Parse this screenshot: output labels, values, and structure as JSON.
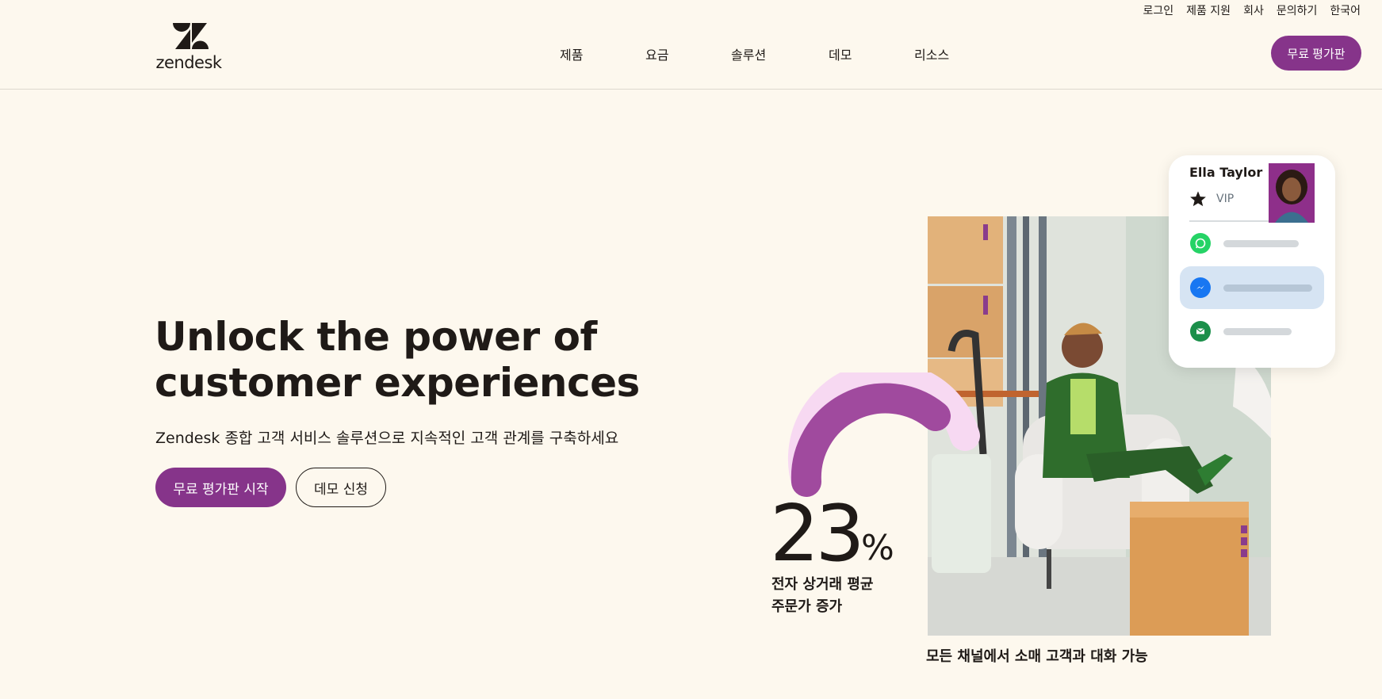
{
  "utility_nav": [
    "로그인",
    "제품 지원",
    "회사",
    "문의하기",
    "한국어"
  ],
  "logo": {
    "text": "zendesk"
  },
  "main_nav": [
    "제품",
    "요금",
    "솔루션",
    "데모",
    "리소스"
  ],
  "header_cta": "무료 평가판",
  "hero": {
    "title": "Unlock the power of customer experiences",
    "subtitle": "Zendesk 종합 고객 서비스 솔루션으로 지속적인 고객 관계를 구축하세요",
    "primary_cta": "무료 평가판 시작",
    "secondary_cta": "데모 신청"
  },
  "stat": {
    "value": "23",
    "unit": "%",
    "caption_line1": "전자 상거래 평균",
    "caption_line2": "주문가 증가",
    "gauge_fraction": 0.6
  },
  "photo_caption": "모든 채널에서 소매 고객과 대화 가능",
  "profile_card": {
    "name": "Ella Taylor",
    "tier": "VIP",
    "tier_icon": "star-icon",
    "channels": [
      {
        "icon": "whatsapp-icon",
        "color": "#25d366",
        "active": false
      },
      {
        "icon": "messenger-icon",
        "color": "#1877f2",
        "active": true
      },
      {
        "icon": "email-icon",
        "color": "#1b8f4a",
        "active": false
      }
    ]
  },
  "colors": {
    "brand_purple": "#86348a",
    "background": "#fdf8ee",
    "gauge_light": "#f7d9f2",
    "text": "#1f1a17"
  }
}
